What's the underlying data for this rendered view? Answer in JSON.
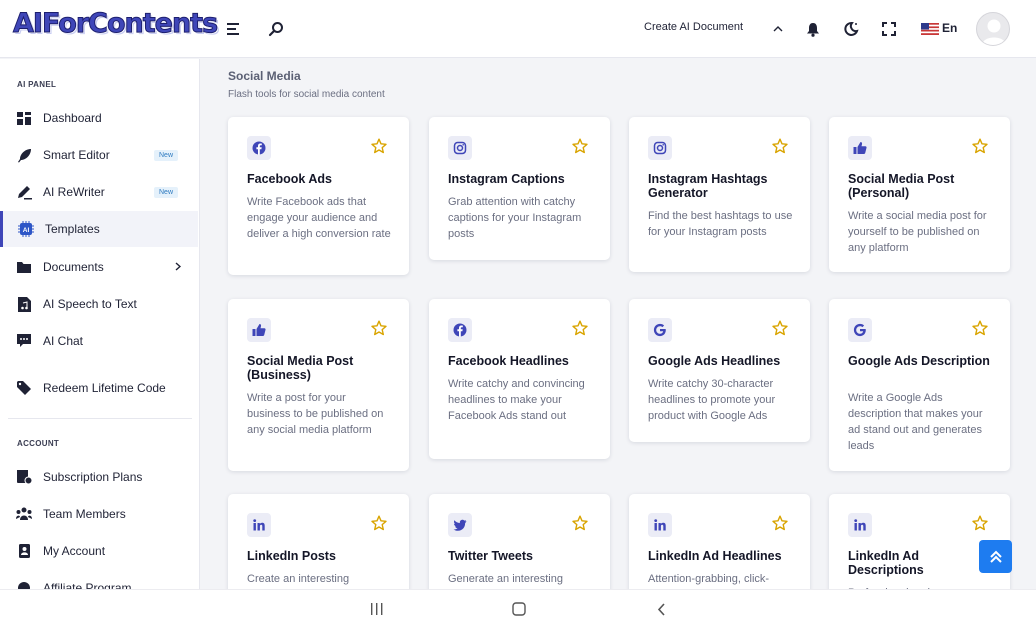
{
  "header": {
    "logo_text": "AIForContents",
    "create_doc_label": "Create AI Document",
    "lang_label": "En",
    "icons": [
      "menu-icon",
      "search-icon",
      "chevron-up-icon",
      "bell-icon",
      "dark-mode-icon",
      "fullscreen-icon",
      "us-flag-icon",
      "avatar"
    ]
  },
  "sidebar": {
    "section_ai": "AI PANEL",
    "section_account": "ACCOUNT",
    "items": [
      {
        "label": "Dashboard",
        "icon": "dashboard-icon"
      },
      {
        "label": "Smart Editor",
        "icon": "feather-icon",
        "badge": "New"
      },
      {
        "label": "AI ReWriter",
        "icon": "pen-icon",
        "badge": "New"
      },
      {
        "label": "Templates",
        "icon": "ai-chip-icon",
        "active": true
      },
      {
        "label": "Documents",
        "icon": "folder-icon"
      },
      {
        "label": "AI Speech to Text",
        "icon": "audio-file-icon"
      },
      {
        "label": "AI Chat",
        "icon": "chat-icon"
      },
      {
        "label": "Redeem Lifetime Code",
        "icon": "tag-icon"
      },
      {
        "label": "Subscription Plans",
        "icon": "subscription-icon"
      },
      {
        "label": "Team Members",
        "icon": "team-icon"
      },
      {
        "label": "My Account",
        "icon": "account-icon"
      },
      {
        "label": "Affiliate Program",
        "icon": "affiliate-icon"
      }
    ]
  },
  "main": {
    "section_title": "Social Media",
    "section_subtitle": "Flash tools for social media content",
    "cards": [
      {
        "title": "Facebook Ads",
        "desc": "Write Facebook ads that engage your audience and deliver a high conversion rate",
        "icon": "facebook-icon"
      },
      {
        "title": "Instagram Captions",
        "desc": "Grab attention with catchy captions for your Instagram posts",
        "icon": "instagram-icon"
      },
      {
        "title": "Instagram Hashtags Generator",
        "desc": "Find the best hashtags to use for your Instagram posts",
        "icon": "instagram-icon"
      },
      {
        "title": "Social Media Post (Personal)",
        "desc": "Write a social media post for yourself to be published on any platform",
        "icon": "thumbs-up-icon"
      },
      {
        "title": "Social Media Post (Business)",
        "desc": "Write a post for your business to be published on any social media platform",
        "icon": "thumbs-up-icon"
      },
      {
        "title": "Facebook Headlines",
        "desc": "Write catchy and convincing headlines to make your Facebook Ads stand out",
        "icon": "facebook-icon"
      },
      {
        "title": "Google Ads Headlines",
        "desc": "Write catchy 30-character headlines to promote your product with Google Ads",
        "icon": "google-icon"
      },
      {
        "title": "Google Ads Description",
        "desc": "Write a Google Ads description that makes your ad stand out and generates leads",
        "icon": "google-icon"
      },
      {
        "title": "LinkedIn Posts",
        "desc": "Create an interesting",
        "icon": "linkedin-icon"
      },
      {
        "title": "Twitter Tweets",
        "desc": "Generate an interesting",
        "icon": "twitter-icon"
      },
      {
        "title": "LinkedIn Ad Headlines",
        "desc": "Attention-grabbing, click-",
        "icon": "linkedin-icon"
      },
      {
        "title": "LinkedIn Ad Descriptions",
        "desc": "Professional and",
        "icon": "linkedin-icon"
      }
    ]
  },
  "colors": {
    "accent": "#3f46b8",
    "star": "#d9a400",
    "scroll_button": "#1e7cf0"
  }
}
